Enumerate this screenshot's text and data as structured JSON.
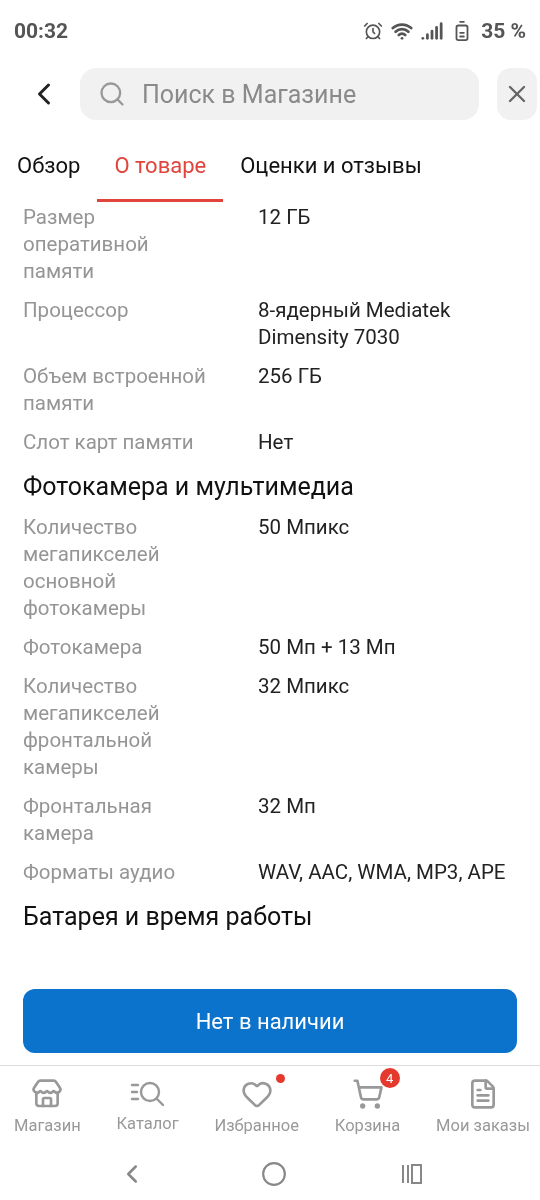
{
  "status_bar": {
    "time": "00:32",
    "battery": "35 %"
  },
  "header": {
    "search": {
      "placeholder": "Поиск в Магазине"
    }
  },
  "tabs": [
    {
      "label": "Обзор",
      "selected": false
    },
    {
      "label": "О товаре",
      "selected": true
    },
    {
      "label": "Оценки и отзывы",
      "selected": false
    }
  ],
  "specs": [
    {
      "kind": "row",
      "label": "Размер оперативной памяти",
      "value": "12 ГБ"
    },
    {
      "kind": "row",
      "label": "Процессор",
      "value": "8-ядерный Mediatek Dimensity 7030"
    },
    {
      "kind": "row",
      "label": "Объем встроенной памяти",
      "value": "256 ГБ"
    },
    {
      "kind": "row",
      "label": "Слот карт памяти",
      "value": "Нет"
    },
    {
      "kind": "heading",
      "label": "Фотокамера и мультимедиа"
    },
    {
      "kind": "row",
      "label": "Количество мегапикселей основной фотокамеры",
      "value": "50 Мпикс"
    },
    {
      "kind": "row",
      "label": "Фотокамера",
      "value": "50 Мп + 13 Мп"
    },
    {
      "kind": "row",
      "label": "Количество мегапикселей фронтальной камеры",
      "value": "32 Мпикс"
    },
    {
      "kind": "row",
      "label": "Фронтальная камера",
      "value": "32 Мп"
    },
    {
      "kind": "row",
      "label": "Форматы аудио",
      "value": "WAV, AAC, WMA, MP3, APE"
    },
    {
      "kind": "heading",
      "label": "Батарея и время работы"
    }
  ],
  "action_button": "Нет в наличии",
  "bottom_nav": [
    {
      "kind": "shop",
      "label": "Магазин"
    },
    {
      "kind": "catalog",
      "label": "Каталог"
    },
    {
      "kind": "favorites",
      "label": "Избранное",
      "dot": true
    },
    {
      "kind": "cart",
      "label": "Корзина",
      "badge": "4"
    },
    {
      "kind": "orders",
      "label": "Мои заказы"
    }
  ]
}
